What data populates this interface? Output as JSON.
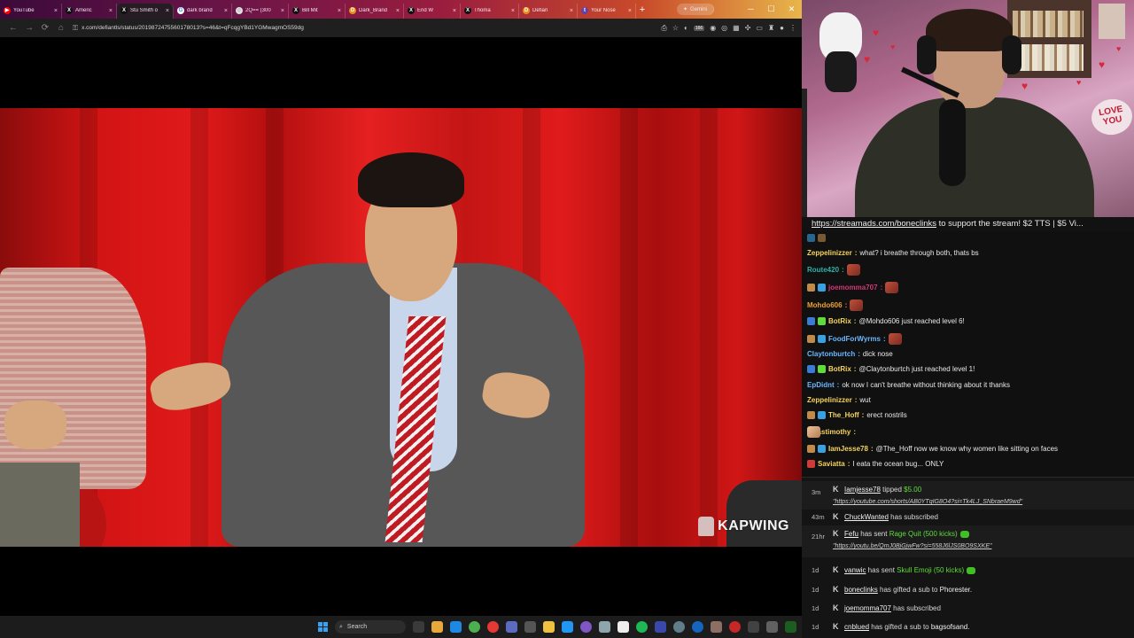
{
  "browser": {
    "tabs": [
      {
        "label": "YouTube",
        "icon": "youtube-icon",
        "fav": "▶"
      },
      {
        "label": "Americ",
        "icon": "x-icon",
        "fav": "X"
      },
      {
        "label": "Stu Smith o",
        "icon": "x-icon",
        "fav": "X"
      },
      {
        "label": "dark brand",
        "icon": "google-icon",
        "fav": "G"
      },
      {
        "label": "2Q== (300",
        "icon": "image-icon",
        "fav": "◌"
      },
      {
        "label": "Bill Mit",
        "icon": "x-icon",
        "fav": "X"
      },
      {
        "label": "Dark_Brand",
        "icon": "df-icon",
        "fav": "D"
      },
      {
        "label": "End W",
        "icon": "x-icon",
        "fav": "X"
      },
      {
        "label": "Thoma",
        "icon": "x-icon",
        "fav": "X"
      },
      {
        "label": "Defian",
        "icon": "df-icon",
        "fav": "D"
      },
      {
        "label": "Your Nose",
        "icon": "twitch-icon",
        "fav": "t"
      }
    ],
    "gemini_label": "Gemini",
    "url": "x.com/defiantls/status/2019872475560178013?s=46&t=qFcqgYBd1YGMwagmOS59dg",
    "ext_badge": "166"
  },
  "video": {
    "watermark": "KAPWING"
  },
  "taskbar": {
    "search_label": "Search"
  },
  "stream": {
    "ticker_link": "https://streamads.com/boneclinks",
    "ticker_text": " to support the stream! $2 TTS | $5 Vi..."
  },
  "chat": [
    {
      "user": "Zeppelinizzer",
      "color": "#f4d35e",
      "text": "what? i breathe through both, thats bs",
      "badges": [],
      "emote": false
    },
    {
      "user": "Route420",
      "color": "#2bb3a7",
      "text": "",
      "badges": [],
      "emote": "meme"
    },
    {
      "user": "joemomma707",
      "color": "#d2367a",
      "text": "",
      "badges": [
        "#c08a4a",
        "#3aa0e0"
      ],
      "emote": "meme"
    },
    {
      "user": "Mohdo606",
      "color": "#f0a030",
      "text": "",
      "badges": [],
      "emote": "meme"
    },
    {
      "user": "BotRix",
      "color": "#f4d35e",
      "text": "@Mohdo606 just reached level 6!",
      "badges": [
        "#3a7bd5",
        "#5fdc3a"
      ],
      "emote": false
    },
    {
      "user": "FoodForWyrms",
      "color": "#6ab7ff",
      "text": "",
      "badges": [
        "#c08a4a",
        "#3aa0e0"
      ],
      "emote": "meme"
    },
    {
      "user": "Claytonburtch",
      "color": "#6ab7ff",
      "text": "dick nose",
      "badges": [],
      "emote": false
    },
    {
      "user": "BotRix",
      "color": "#f4d35e",
      "text": "@Claytonburtch just reached level 1!",
      "badges": [
        "#3a7bd5",
        "#5fdc3a"
      ],
      "emote": false
    },
    {
      "user": "EpDidnt",
      "color": "#6ab7ff",
      "text": "ok now I can't breathe without thinking about it thanks",
      "badges": [],
      "emote": false
    },
    {
      "user": "Zeppelinizzer",
      "color": "#f4d35e",
      "text": "wut",
      "badges": [],
      "emote": false
    },
    {
      "user": "The_Hoff",
      "color": "#f4d35e",
      "text": "erect nostrils",
      "badges": [
        "#c08a4a",
        "#3aa0e0"
      ],
      "emote": false
    },
    {
      "user": "lucastimothy",
      "color": "#f4d35e",
      "text": "",
      "badges": [],
      "emote": "face"
    },
    {
      "user": "IamJesse78",
      "color": "#f4d35e",
      "text": "@The_Hoff now we know why women like sitting on faces",
      "badges": [
        "#c08a4a",
        "#3aa0e0"
      ],
      "emote": false
    },
    {
      "user": "Saviatta",
      "color": "#f4d35e",
      "text": "I eata the ocean bug... ONLY",
      "badges": [
        "#d23a3a"
      ],
      "emote": false
    }
  ],
  "activity": [
    {
      "time": "3m",
      "user": "Iamjesse78",
      "action": " tipped ",
      "extra": "$5.00",
      "extra_color": "#5fdc3a",
      "link": "\"https://youtube.com/shorts/AB0YTqIG8O4?si=Tk4LJ_SNbraeM9wd\"",
      "gem": false,
      "highlight": true
    },
    {
      "time": "43m",
      "user": "ChuckWanted",
      "action": " has subscribed",
      "extra": "",
      "link": "",
      "gem": false,
      "highlight": false
    },
    {
      "time": "21hr",
      "user": "Fefu",
      "action": " has sent ",
      "extra": "Rage Quit (500 kicks)",
      "extra_color": "#5fdc3a",
      "link": "\"https://youtu.be/QmJ0BjGjwFw?si=558J6lJS0BO9SXKE\"",
      "gem": true,
      "highlight": true
    },
    {
      "time": "1d",
      "user": "vanwic",
      "action": " has sent ",
      "extra": "Skull Emoji (50 kicks)",
      "extra_color": "#5fdc3a",
      "link": "",
      "gem": true,
      "highlight": false
    },
    {
      "time": "1d",
      "user": "boneclinks",
      "action": " has gifted a sub to ",
      "extra": "Phorester.",
      "extra_color": "#f0f0f0",
      "link": "",
      "gem": false,
      "highlight": false
    },
    {
      "time": "1d",
      "user": "joemomma707",
      "action": " has subscribed",
      "extra": "",
      "link": "",
      "gem": false,
      "highlight": false
    },
    {
      "time": "1d",
      "user": "cnblued",
      "action": " has gifted a sub to ",
      "extra": "bagsofsand.",
      "extra_color": "#f0f0f0",
      "link": "",
      "gem": false,
      "highlight": false
    }
  ]
}
